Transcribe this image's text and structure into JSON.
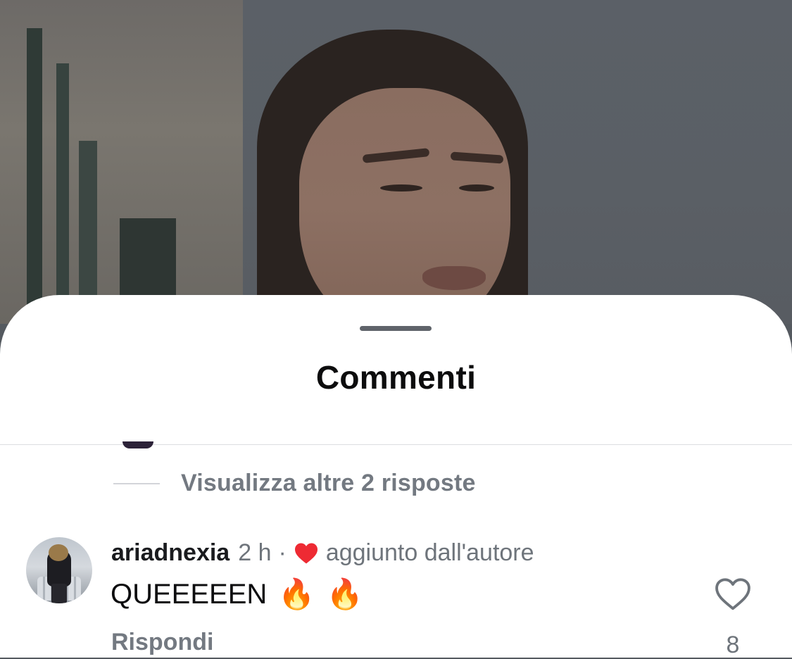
{
  "sheet": {
    "title": "Commenti"
  },
  "replies": {
    "label": "Visualizza altre 2 risposte"
  },
  "comment": {
    "username": "ariadnexia",
    "time": "2 h",
    "separator": "·",
    "liked_by_author_note": "aggiunto dall'autore",
    "text": "QUEEEEEN",
    "emojis": [
      "🔥",
      "🔥"
    ],
    "reply_label": "Rispondi",
    "like_count": "8"
  },
  "icons": {
    "author_heart": "heart-filled-icon",
    "like": "heart-outline-icon"
  },
  "colors": {
    "author_heart": "#ee2a33",
    "secondary_text": "#737981",
    "primary_text": "#0d0d0f"
  }
}
